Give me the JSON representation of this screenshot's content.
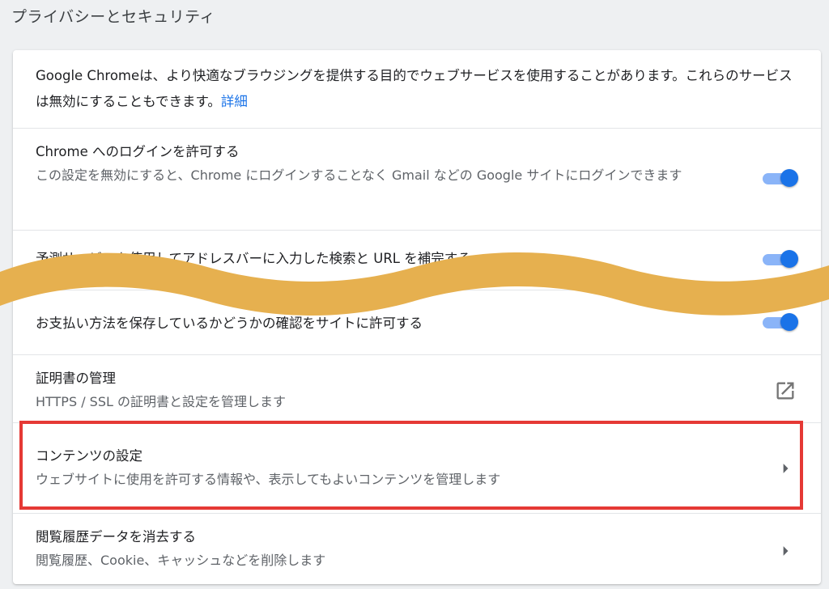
{
  "section": {
    "title": "プライバシーとセキュリティ"
  },
  "intro": {
    "text": "Google Chromeは、より快適なブラウジングを提供する目的でウェブサービスを使用することがあります。これらのサービスは無効にすることもできます。",
    "link": "詳細"
  },
  "settings": [
    {
      "label": "Chrome へのログインを許可する",
      "description": "この設定を無効にすると、Chrome にログインすることなく Gmail などの Google サイトにログインできます",
      "control": "toggle",
      "enabled": true
    },
    {
      "label": "予測サービスを使用してアドレスバーに入力した検索と URL を補完する",
      "description": "",
      "control": "toggle",
      "enabled": true
    },
    {
      "label": "お支払い方法を保存しているかどうかの確認をサイトに許可する",
      "description": "",
      "control": "toggle",
      "enabled": true
    },
    {
      "label": "証明書の管理",
      "description": "HTTPS / SSL の証明書と設定を管理します",
      "control": "external-link"
    },
    {
      "label": "コンテンツの設定",
      "description": "ウェブサイトに使用を許可する情報や、表示してもよいコンテンツを管理します",
      "control": "chevron",
      "highlighted": true
    },
    {
      "label": "閲覧履歴データを消去する",
      "description": "閲覧履歴、Cookie、キャッシュなどを削除します",
      "control": "chevron"
    }
  ],
  "colors": {
    "accent": "#1a73e8",
    "toggle_track": "#8ab4f8",
    "highlight_border": "#e53935",
    "wave_overlay": "#e6b04f"
  },
  "icons": {
    "external": "open-in-new-icon",
    "chevron": "chevron-right-icon"
  }
}
